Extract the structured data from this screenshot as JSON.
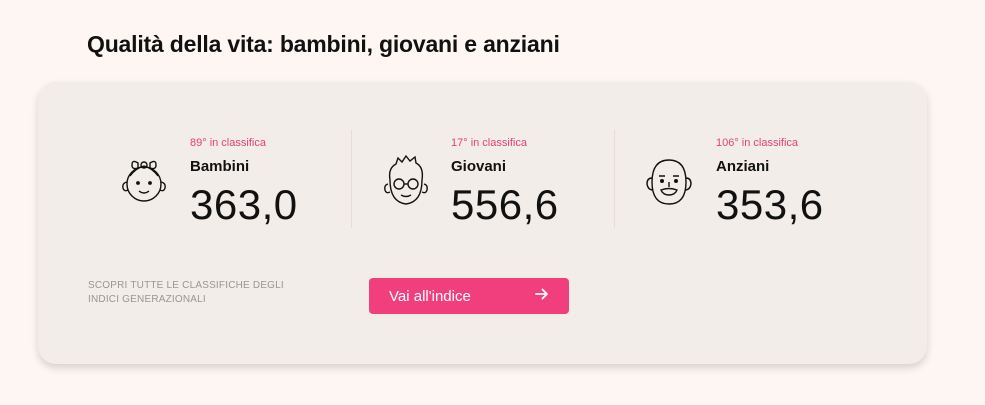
{
  "page": {
    "title": "Qualità della vita: bambini, giovani e anziani"
  },
  "stats": [
    {
      "icon": "baby-face-icon",
      "rank": "89° in classifica",
      "label": "Bambini",
      "value": "363,0"
    },
    {
      "icon": "young-face-glasses-icon",
      "rank": "17° in classifica",
      "label": "Giovani",
      "value": "556,6"
    },
    {
      "icon": "elderly-face-icon",
      "rank": "106° in classifica",
      "label": "Anziani",
      "value": "353,6"
    }
  ],
  "footer": {
    "text": "Scopri tutte le classifiche degli indici generazionali",
    "button_label": "Vai all'indice",
    "button_icon": "arrow-right-icon"
  },
  "colors": {
    "accent": "#f03f7c",
    "rank_text": "#e64079",
    "card_bg": "#f2ede8",
    "page_bg": "#fdf6f2"
  }
}
